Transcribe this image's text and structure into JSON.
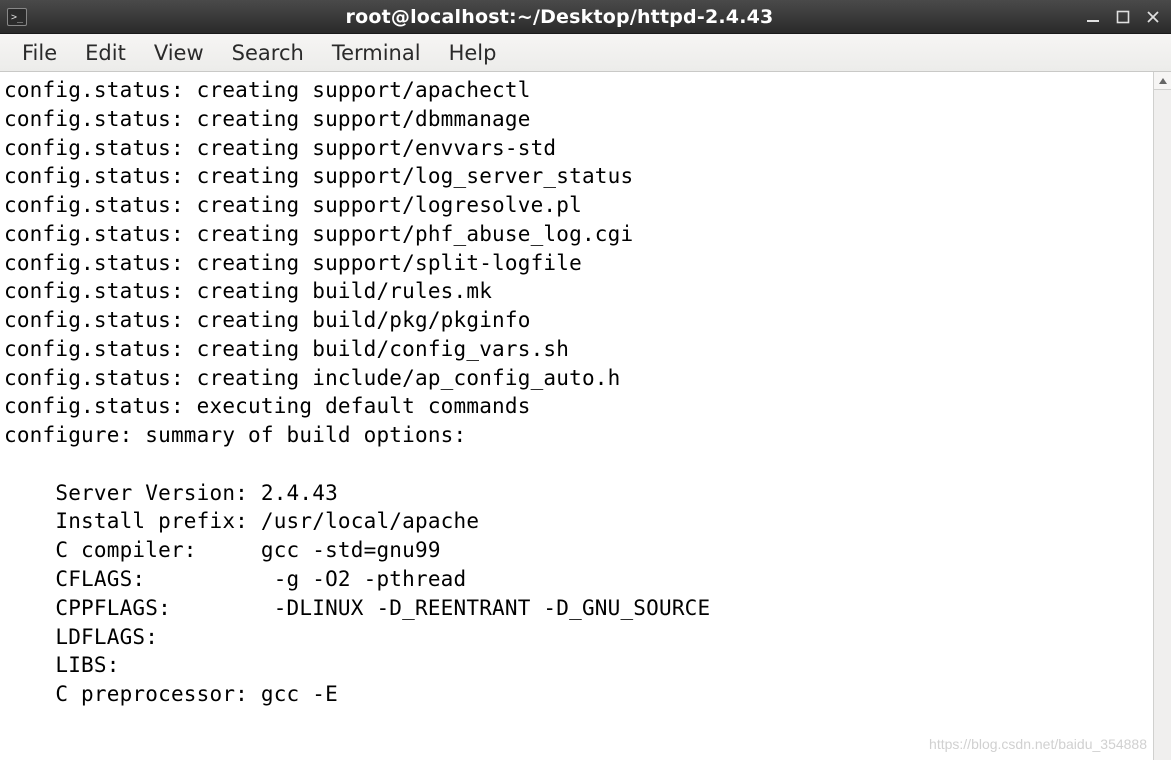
{
  "window": {
    "title": "root@localhost:~/Desktop/httpd-2.4.43"
  },
  "menu": {
    "file": "File",
    "edit": "Edit",
    "view": "View",
    "search": "Search",
    "terminal": "Terminal",
    "help": "Help"
  },
  "terminal": {
    "lines": [
      "config.status: creating support/apachectl",
      "config.status: creating support/dbmmanage",
      "config.status: creating support/envvars-std",
      "config.status: creating support/log_server_status",
      "config.status: creating support/logresolve.pl",
      "config.status: creating support/phf_abuse_log.cgi",
      "config.status: creating support/split-logfile",
      "config.status: creating build/rules.mk",
      "config.status: creating build/pkg/pkginfo",
      "config.status: creating build/config_vars.sh",
      "config.status: creating include/ap_config_auto.h",
      "config.status: executing default commands",
      "configure: summary of build options:",
      "",
      "    Server Version: 2.4.43",
      "    Install prefix: /usr/local/apache",
      "    C compiler:     gcc -std=gnu99",
      "    CFLAGS:          -g -O2 -pthread  ",
      "    CPPFLAGS:        -DLINUX -D_REENTRANT -D_GNU_SOURCE  ",
      "    LDFLAGS:           ",
      "    LIBS:             ",
      "    C preprocessor: gcc -E"
    ]
  },
  "watermark": "https://blog.csdn.net/baidu_354888"
}
